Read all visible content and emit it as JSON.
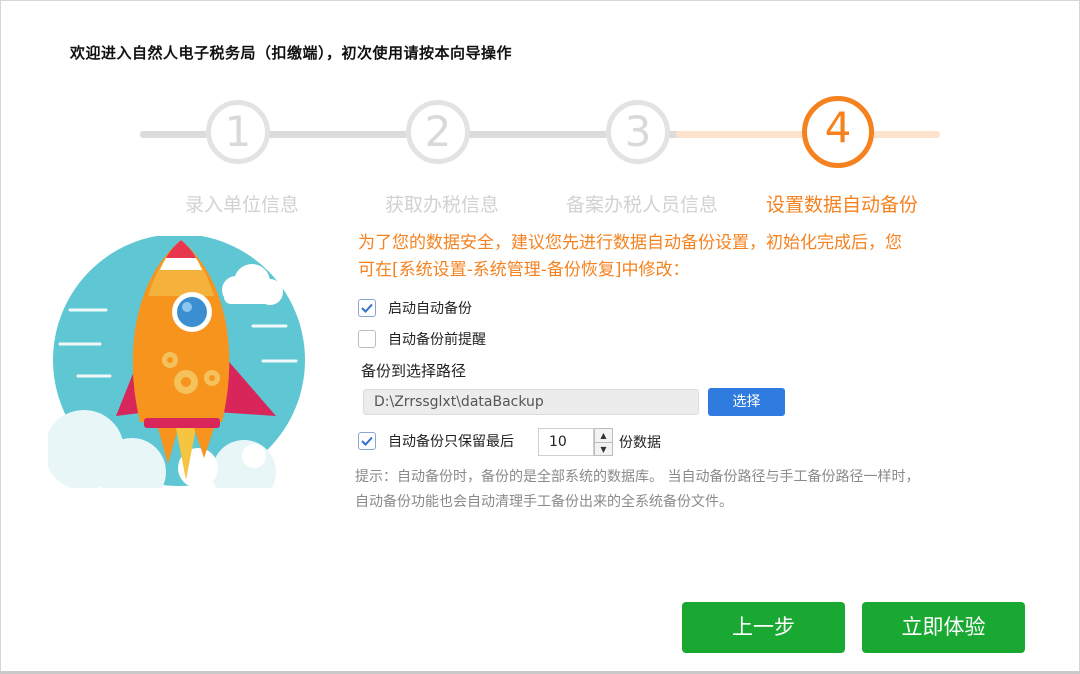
{
  "header": {
    "welcome": "欢迎进入自然人电子税务局（扣缴端），初次使用请按本向导操作"
  },
  "colors": {
    "accent": "#f5821f",
    "primary_button": "#2f7be0",
    "action_button": "#19a933",
    "inactive_step": "#d2d2d2"
  },
  "steps": [
    {
      "number": "1",
      "label": "录入单位信息",
      "state": "done"
    },
    {
      "number": "2",
      "label": "获取办税信息",
      "state": "done"
    },
    {
      "number": "3",
      "label": "备案办税人员信息",
      "state": "done"
    },
    {
      "number": "4",
      "label": "设置数据自动备份",
      "state": "active"
    }
  ],
  "notice": "为了您的数据安全，建议您先进行数据自动备份设置，初始化完成后，您可在[系统设置-系统管理-备份恢复]中修改：",
  "options": {
    "enable_auto_backup": {
      "label": "启动自动备份",
      "checked": true
    },
    "remind_before_backup": {
      "label": "自动备份前提醒",
      "checked": false
    },
    "keep_last": {
      "label": "自动备份只保留最后",
      "checked": true,
      "value": "10",
      "unit": "份数据"
    }
  },
  "backup_path": {
    "title": "备份到选择路径",
    "value": "D:\\Zrrssglxt\\dataBackup",
    "choose_label": "选择"
  },
  "tip": "提示：自动备份时，备份的是全部系统的数据库。 当自动备份路径与手工备份路径一样时，自动备份功能也会自动清理手工备份出来的全系统备份文件。",
  "buttons": {
    "prev": "上一步",
    "start": "立即体验"
  },
  "illustration": {
    "icon": "rocket-icon"
  }
}
